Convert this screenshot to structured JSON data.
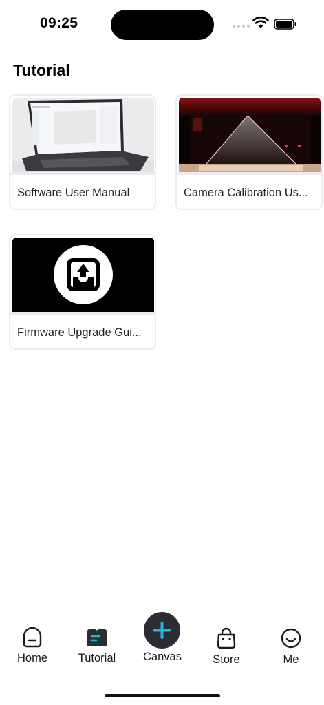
{
  "status": {
    "time": "09:25"
  },
  "page": {
    "title": "Tutorial"
  },
  "cards": [
    {
      "label": "Software User Manual",
      "thumb_icon": "laptop-image"
    },
    {
      "label": "Camera Calibration Us...",
      "thumb_icon": "laser-machine-image"
    },
    {
      "label": "Firmware Upgrade Gui...",
      "thumb_icon": "upload-icon"
    }
  ],
  "tabs": {
    "home": "Home",
    "tutorial": "Tutorial",
    "canvas": "Canvas",
    "store": "Store",
    "me": "Me"
  },
  "colors": {
    "accent": "#22b8d8",
    "tab_active_bg": "#2a2d33",
    "card_border": "#ececf0"
  }
}
